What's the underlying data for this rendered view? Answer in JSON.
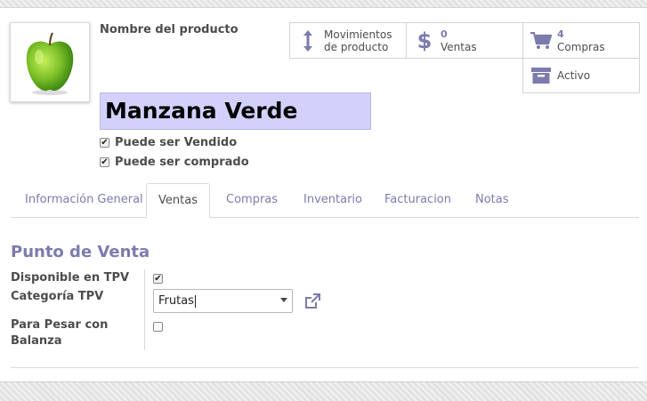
{
  "product": {
    "name_label": "Nombre del producto",
    "name": "Manzana Verde",
    "image": "green-apple"
  },
  "checks": {
    "sale_ok_label": "Puede ser Vendido",
    "sale_ok": true,
    "purchase_ok_label": "Puede ser comprado",
    "purchase_ok": true
  },
  "smart_buttons": {
    "moves": {
      "line1": "Movimientos",
      "line2": "de producto",
      "icon": "arrows-vertical-icon"
    },
    "sales": {
      "count": "0",
      "label": "Ventas",
      "icon": "dollar-icon"
    },
    "purchases": {
      "count": "4",
      "label": "Compras",
      "icon": "shopping-cart-icon"
    },
    "active": {
      "label": "Activo",
      "icon": "archive-box-icon"
    }
  },
  "tabs": [
    {
      "label": "Información General",
      "active": false
    },
    {
      "label": "Ventas",
      "active": true
    },
    {
      "label": "Compras",
      "active": false
    },
    {
      "label": "Inventario",
      "active": false
    },
    {
      "label": "Facturacion",
      "active": false
    },
    {
      "label": "Notas",
      "active": false
    }
  ],
  "pos": {
    "title": "Punto de Venta",
    "available_label": "Disponible en TPV",
    "available": true,
    "category_label": "Categoría TPV",
    "category_value": "Frutas",
    "scale_label_1": "Para Pesar con",
    "scale_label_2": "Balanza",
    "to_weight": false
  },
  "colors": {
    "accent": "#7c7bad",
    "name_bg": "#d1d1fc"
  }
}
